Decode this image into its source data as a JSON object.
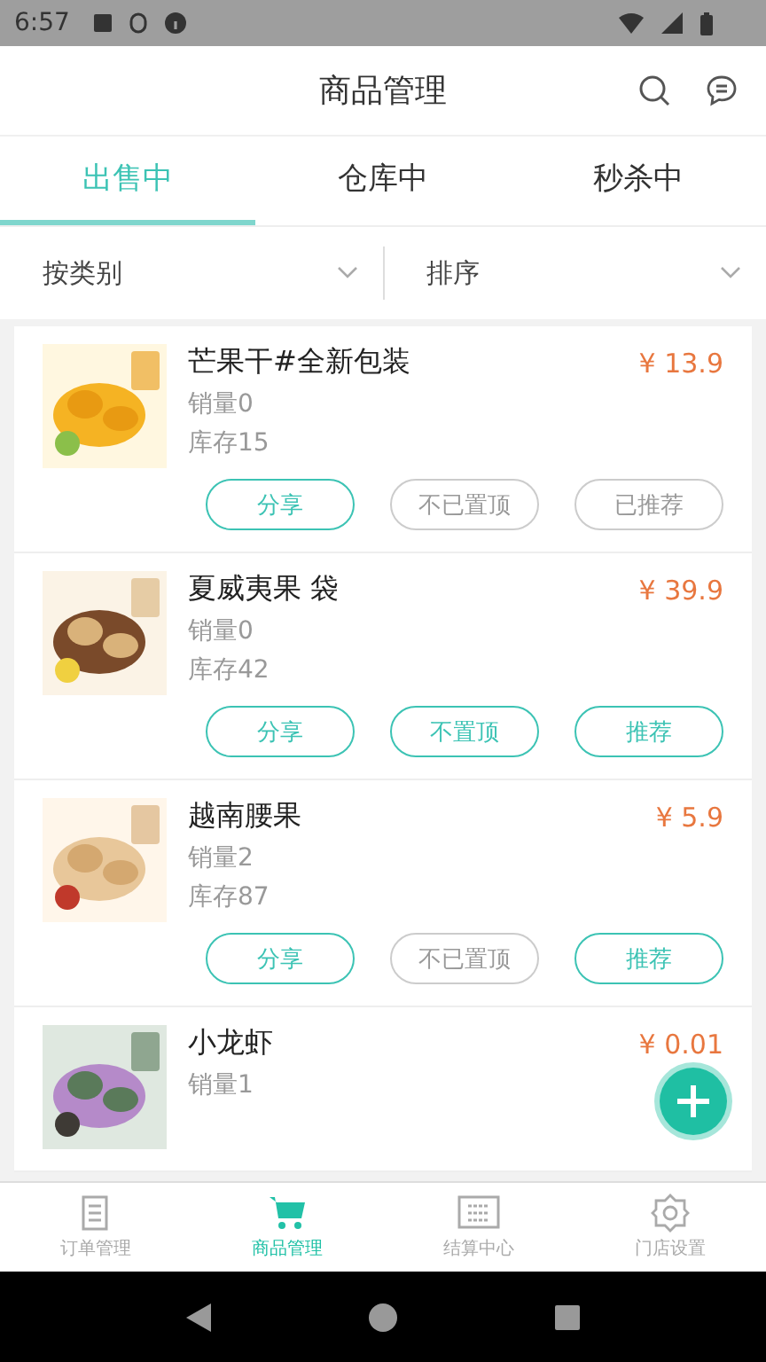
{
  "status_bar": {
    "time": "6:57"
  },
  "header": {
    "title": "商品管理"
  },
  "tabs": [
    {
      "label": "出售中",
      "selected": true
    },
    {
      "label": "仓库中",
      "selected": false
    },
    {
      "label": "秒杀中",
      "selected": false
    }
  ],
  "filters": [
    {
      "label": "按类别"
    },
    {
      "label": "排序"
    }
  ],
  "products": [
    {
      "name": "芒果干#全新包装",
      "price": "¥ 13.9",
      "sales": "销量0",
      "stock": "库存15",
      "image": {
        "kind": "picture"
      },
      "buttons": [
        {
          "label": "分享",
          "on": true
        },
        {
          "label": "不已置顶",
          "on": false
        },
        {
          "label": "已推荐",
          "on": false
        }
      ]
    },
    {
      "name": "夏威夷果 袋",
      "price": "¥ 39.9",
      "sales": "销量0",
      "stock": "库存42",
      "image": {
        "kind": "picture"
      },
      "buttons": [
        {
          "label": "分享",
          "on": true
        },
        {
          "label": "不置顶",
          "on": true
        },
        {
          "label": "推荐",
          "on": true
        }
      ]
    },
    {
      "name": "越南腰果",
      "price": "¥ 5.9",
      "sales": "销量2",
      "stock": "库存87",
      "image": {
        "kind": "picture"
      },
      "buttons": [
        {
          "label": "分享",
          "on": true
        },
        {
          "label": "不已置顶",
          "on": false
        },
        {
          "label": "推荐",
          "on": true
        }
      ]
    },
    {
      "name": "小龙虾",
      "price": "¥ 0.01",
      "sales": "销量1",
      "image": {
        "kind": "picture"
      }
    }
  ],
  "bottom_nav": [
    {
      "label": "订单管理",
      "selected": false
    },
    {
      "label": "商品管理",
      "selected": true
    },
    {
      "label": "结算中心",
      "selected": false
    },
    {
      "label": "门店设置",
      "selected": false
    }
  ]
}
